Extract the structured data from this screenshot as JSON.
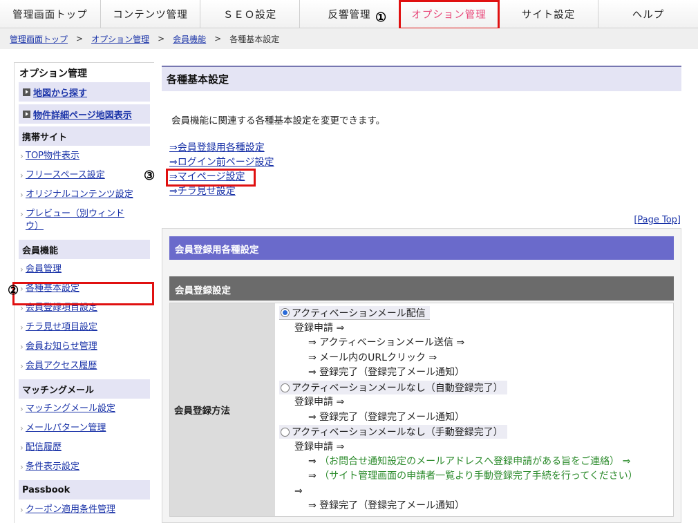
{
  "topnav": {
    "tabs": [
      {
        "label": "管理画面トップ",
        "width": 146
      },
      {
        "label": "コンテンツ管理",
        "width": 144
      },
      {
        "label": "ＳＥＯ設定",
        "width": 144
      },
      {
        "label": "反響管理",
        "width": 144
      },
      {
        "label": "オプション管理",
        "width": 144,
        "active": true
      },
      {
        "label": "サイト設定",
        "width": 144
      },
      {
        "label": "ヘルプ",
        "width": 144
      }
    ],
    "annotation_1": "①"
  },
  "breadcrumb": {
    "items": [
      "管理画面トップ",
      "オプション管理",
      "会員機能"
    ],
    "separator": ">",
    "current": "各種基本設定"
  },
  "sidebar": {
    "title": "オプション管理",
    "buttons": [
      "地図から探す",
      "物件詳細ページ地図表示"
    ],
    "sections": [
      {
        "title": "携帯サイト",
        "links": [
          "TOP物件表示",
          "フリースペース設定",
          "オリジナルコンテンツ設定",
          "プレビュー（別ウィンドウ）"
        ]
      },
      {
        "title": "会員機能",
        "links": [
          "会員管理",
          "各種基本設定",
          "会員登録項目設定",
          "チラ見せ項目設定",
          "会員お知らせ管理",
          "会員アクセス履歴"
        ]
      },
      {
        "title": "マッチングメール",
        "links": [
          "マッチングメール設定",
          "メールパターン管理",
          "配信履歴",
          "条件表示設定"
        ]
      },
      {
        "title": "Passbook",
        "links": [
          "クーポン適用条件管理"
        ]
      }
    ],
    "annotation_2": "②"
  },
  "main": {
    "title": "各種基本設定",
    "description": "会員機能に関連する各種基本設定を変更できます。",
    "links": [
      "⇒会員登録用各種設定",
      "⇒ログイン前ページ設定",
      "⇒マイページ設定",
      "⇒チラ見せ設定"
    ],
    "annotation_3": "③",
    "page_top": "[Page Top]",
    "panel_header": "会員登録用各種設定",
    "sub_header": "会員登録設定",
    "field_label": "会員登録方法",
    "options": {
      "opt1": "アクティベーションメール配信",
      "opt1_l1": "登録申請 ⇒",
      "opt1_l2": "⇒ アクティベーションメール送信 ⇒",
      "opt1_l3": "⇒ メール内のURLクリック ⇒",
      "opt1_l4": "⇒ 登録完了（登録完了メール通知）",
      "opt2": "アクティベーションメールなし（自動登録完了）",
      "opt2_l1": "登録申請 ⇒",
      "opt2_l2": "⇒ 登録完了（登録完了メール通知）",
      "opt3": "アクティベーションメールなし（手動登録完了）",
      "opt3_l1": "登録申請 ⇒",
      "opt3_l2_arrow": "⇒",
      "opt3_l2_text": "（お問合せ通知設定のメールアドレスへ登録申請がある旨をご連絡） ⇒",
      "opt3_l3_arrow": "⇒",
      "opt3_l3_text": "（サイト管理画面の申請者一覧より手動登録完了手続を行ってください）",
      "opt3_l4": "⇒",
      "opt3_l5": "⇒ 登録完了（登録完了メール通知）"
    }
  }
}
